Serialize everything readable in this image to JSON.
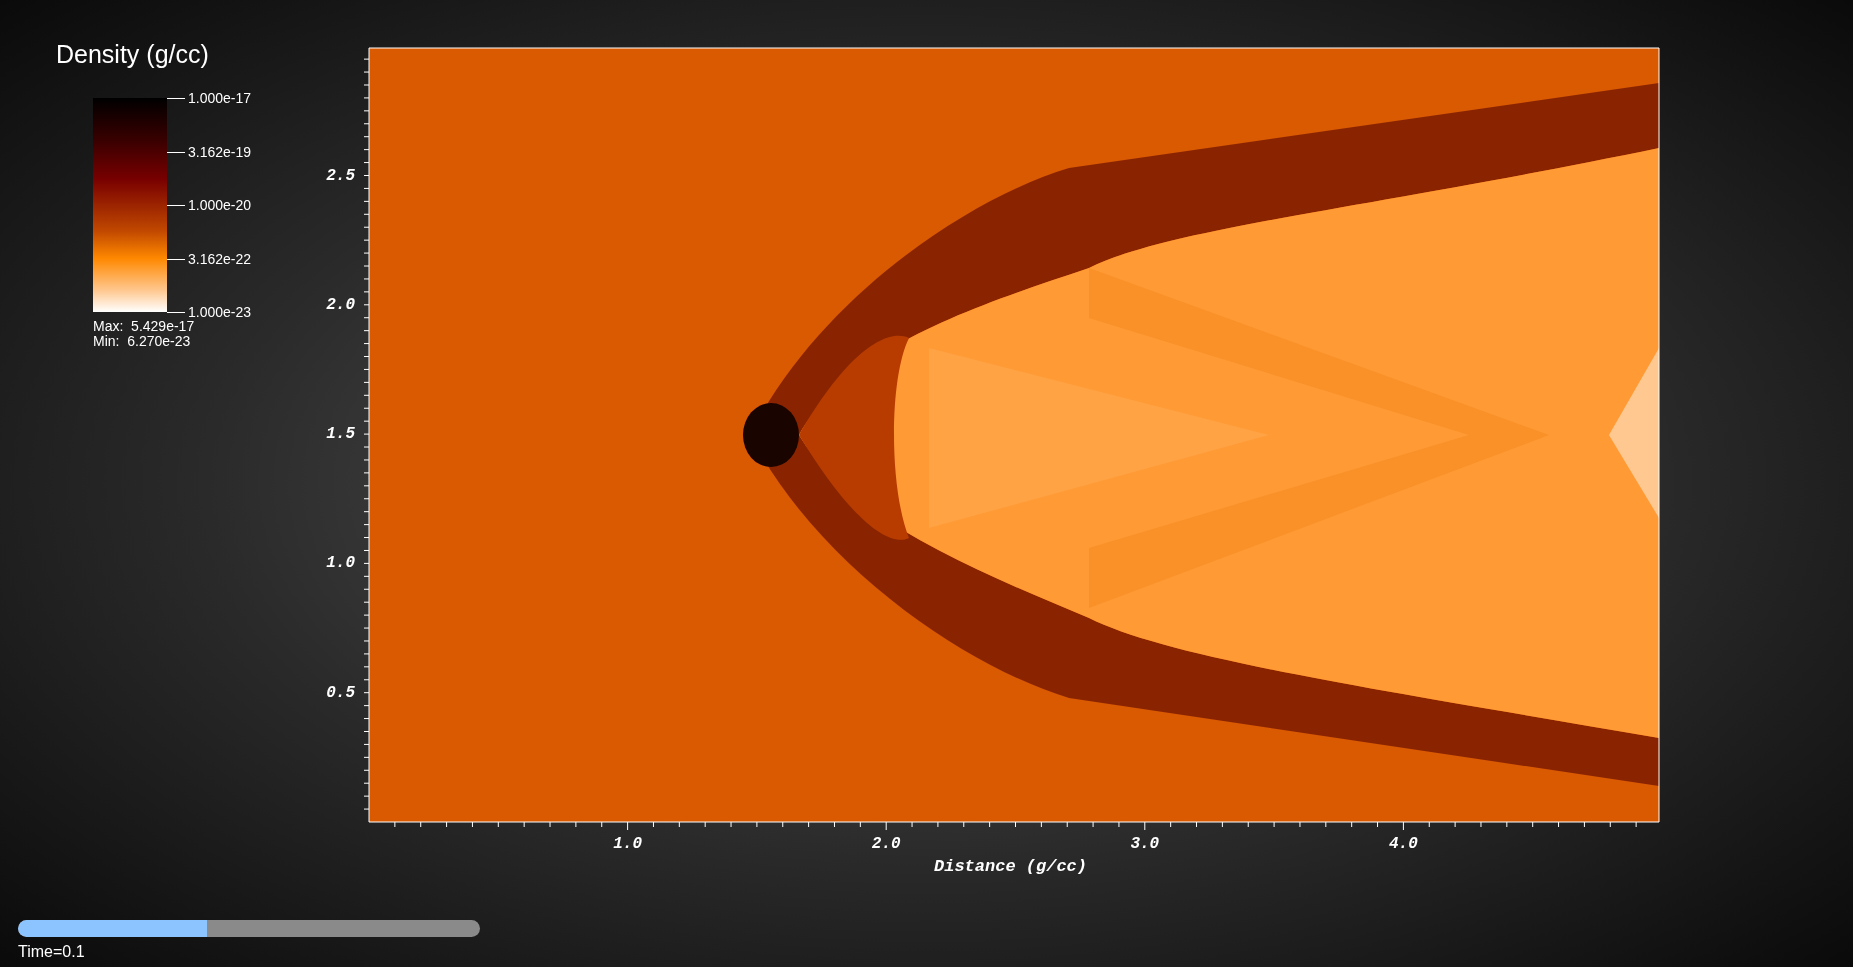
{
  "legend": {
    "title": "Density (g/cc)",
    "tick_labels": [
      "1.000e-17",
      "3.162e-19",
      "1.000e-20",
      "3.162e-22",
      "1.000e-23"
    ],
    "max": "Max:  5.429e-17",
    "min": "Min:  6.270e-23"
  },
  "plot": {
    "x_tick_labels": [
      "1.0",
      "2.0",
      "3.0",
      "4.0"
    ],
    "y_tick_labels": [
      "2.5",
      "2.0",
      "1.5",
      "1.0",
      "0.5"
    ],
    "x_axis_title": "Distance (g/cc)"
  },
  "time_slider": {
    "level": 0.41,
    "label": "Time=0.1"
  }
}
